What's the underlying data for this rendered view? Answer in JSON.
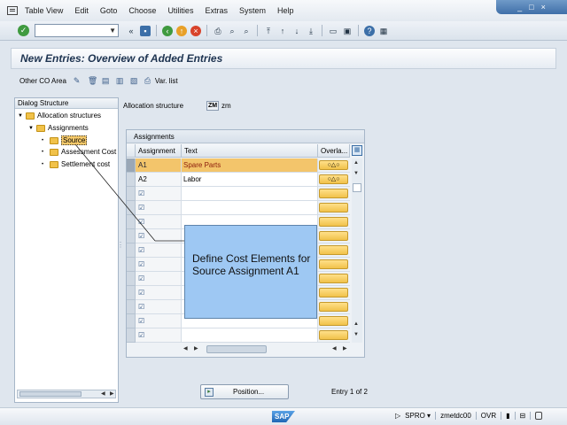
{
  "menu": {
    "items": [
      "Table View",
      "Edit",
      "Goto",
      "Choose",
      "Utilities",
      "Extras",
      "System",
      "Help"
    ]
  },
  "window_controls": {
    "minimize": "_",
    "restore": "□",
    "close": "×"
  },
  "title": "New Entries: Overview of Added Entries",
  "app_toolbar": {
    "other_co_area": "Other CO Area",
    "var_list": "Var. list"
  },
  "tree": {
    "header": "Dialog Structure",
    "nodes": [
      "Allocation structures",
      "Assignments",
      "Source",
      "Assessment Cost",
      "Settlement cost"
    ]
  },
  "allocation_structure": {
    "label": "Allocation structure",
    "value": "ZM",
    "text": "zm"
  },
  "grid": {
    "caption": "Assignments",
    "columns": [
      "Assignment",
      "Text",
      "Overla..."
    ],
    "overlap_symbol": "○△○",
    "rows": [
      {
        "assignment": "A1",
        "text": "Spare Parts"
      },
      {
        "assignment": "A2",
        "text": "Labor"
      },
      {
        "assignment": "",
        "text": ""
      },
      {
        "assignment": "",
        "text": ""
      },
      {
        "assignment": "",
        "text": ""
      },
      {
        "assignment": "",
        "text": ""
      },
      {
        "assignment": "",
        "text": ""
      },
      {
        "assignment": "",
        "text": ""
      },
      {
        "assignment": "",
        "text": ""
      },
      {
        "assignment": "",
        "text": ""
      },
      {
        "assignment": "",
        "text": ""
      },
      {
        "assignment": "",
        "text": ""
      },
      {
        "assignment": "",
        "text": ""
      }
    ]
  },
  "callout": {
    "text": "Define Cost Elements for Source Assignment A1"
  },
  "position_button": "Position...",
  "entry_count": "Entry 1 of 2",
  "status": {
    "transaction": "SPRO",
    "server": "zmetdc00",
    "mode": "OVR"
  },
  "colors": {
    "highlight_row": "#f3c56b",
    "callout": "#9ec8f3",
    "title_text": "#1d3350"
  }
}
